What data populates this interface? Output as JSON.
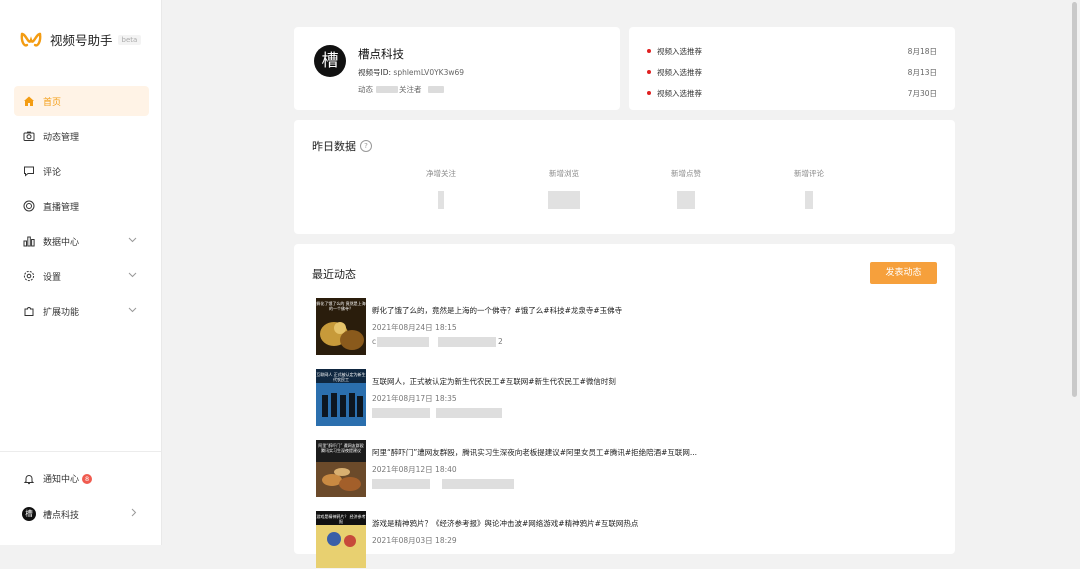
{
  "brand": {
    "title": "视频号助手",
    "badge": "beta",
    "logo_color": "#f39c12"
  },
  "nav": {
    "items": [
      {
        "label": "首页",
        "icon": "home-icon",
        "active": true
      },
      {
        "label": "动态管理",
        "icon": "camera-icon"
      },
      {
        "label": "评论",
        "icon": "comment-icon"
      },
      {
        "label": "直播管理",
        "icon": "live-icon"
      },
      {
        "label": "数据中心",
        "icon": "chart-icon",
        "expandable": true
      },
      {
        "label": "设置",
        "icon": "settings-icon",
        "expandable": true
      },
      {
        "label": "扩展功能",
        "icon": "puzzle-icon",
        "expandable": true
      }
    ]
  },
  "notify": {
    "label": "通知中心",
    "badge": "8"
  },
  "user": {
    "name": "槽点科技",
    "avatar_char": "槽"
  },
  "profile": {
    "name": "槽点科技",
    "avatar_char": "槽",
    "id_label": "视频号ID:",
    "id_value": "sphlemLV0YK3w69",
    "dynamic_label": "动态",
    "follow_label": "关注者"
  },
  "news": [
    {
      "text": "视频入选推荐",
      "date": "8月18日"
    },
    {
      "text": "视频入选推荐",
      "date": "8月13日"
    },
    {
      "text": "视频入选推荐",
      "date": "7月30日"
    }
  ],
  "yesterday": {
    "title": "昨日数据",
    "stats": [
      {
        "label": "净增关注"
      },
      {
        "label": "新增浏览"
      },
      {
        "label": "新增点赞"
      },
      {
        "label": "新增评论"
      }
    ]
  },
  "recent": {
    "title": "最近动态",
    "post_button": "发表动态",
    "posts": [
      {
        "title": "孵化了饿了么的，竟然是上海的一个佛寺？#饿了么#科技#龙泉寺#玉佛寺",
        "time": "2021年08月24日 18:15",
        "stat_start": "c",
        "stat_end": "2",
        "thumb_caption": "孵化了饿了么的 竟然是上海的一个佛寺？"
      },
      {
        "title": "互联网人，正式被认定为新生代农民工#互联网#新生代农民工#微信时刻",
        "time": "2021年08月17日 18:35",
        "thumb_caption": "互联网人 正式被认定为新生代农民工"
      },
      {
        "title": "阿里“醉吓门”遭网友群殴，腾讯实习生深夜向老板提建议#阿里女员工#腾讯#拒绝陪酒#互联网...",
        "time": "2021年08月12日 18:40",
        "thumb_caption": "阿里“醉吓门” 遭网友群殴 腾讯实习生深夜提建议"
      },
      {
        "title": "游戏是精神鸦片？《经济参考报》舆论冲击波#网络游戏#精神鸦片#互联网热点",
        "time": "2021年08月03日 18:29",
        "thumb_caption": "游戏是精神鸦片？ 经济参考报"
      }
    ]
  }
}
